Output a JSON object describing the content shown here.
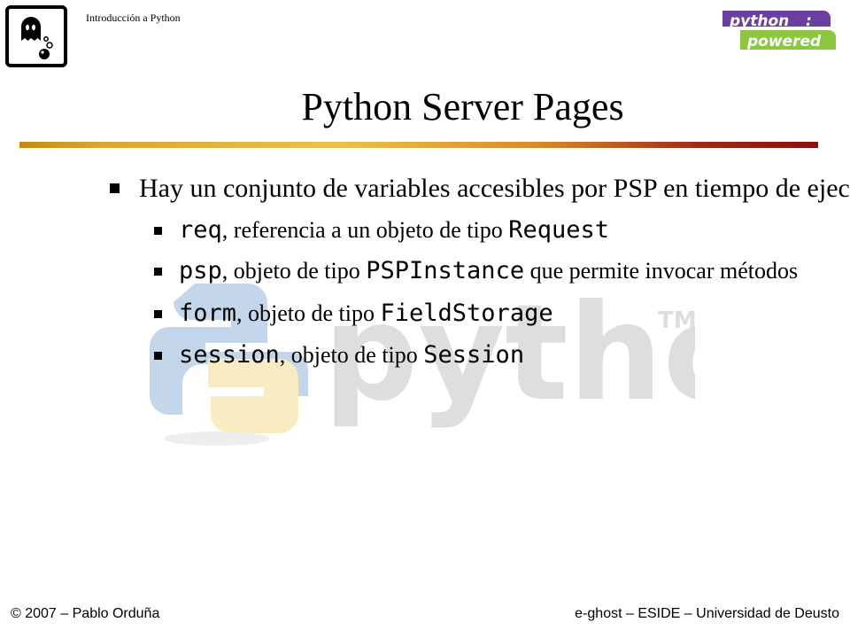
{
  "header": {
    "course_title": "Introducción a Python",
    "logo_icon": "ghost-icon",
    "badge": {
      "line1": "python",
      "line2": "powered",
      "color_top": "#6b3fa0",
      "color_bottom": "#8dc63f"
    }
  },
  "slide": {
    "title": "Python Server Pages",
    "bullets": {
      "main": "Hay un conjunto de variables accesibles por PSP en tiempo de ejecución:",
      "items": [
        {
          "code": "req",
          "text": ", referencia a un objeto de tipo ",
          "code2": "Request",
          "tail": ""
        },
        {
          "code": "psp",
          "text": ", objeto de tipo ",
          "code2": "PSPInstance",
          "tail": " que permite invocar métodos"
        },
        {
          "code": "form",
          "text": ", objeto de tipo ",
          "code2": "FieldStorage",
          "tail": ""
        },
        {
          "code": "session",
          "text": ", objeto de tipo ",
          "code2": "Session",
          "tail": ""
        }
      ]
    },
    "watermark": {
      "text": "python",
      "tm": "TM"
    }
  },
  "footer": {
    "left": "© 2007 – Pablo Orduña",
    "right": "e-ghost – ESIDE – Universidad de Deusto"
  },
  "colors": {
    "rule_start": "#c28a14",
    "rule_end": "#8a1010"
  }
}
